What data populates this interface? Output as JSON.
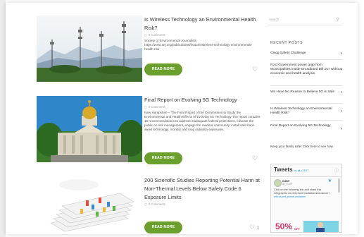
{
  "posts": [
    {
      "title": "Is Wireless Technology an Environmental Health Risk?",
      "comments": "0 Comments",
      "excerpt": "Society of Environmental Journalists https://www.sej.org/publications/feature/wireless-technology-environmental-health-risk",
      "read_more": "READ MORE",
      "likes": ""
    },
    {
      "title": "Final Report on Evolving 5G Technology",
      "comments": "0 Comments",
      "excerpt": "New Hampshire – The Final Report of the Commission to Study the Environmental and Health Effects of Evolving 5G Technology The report contains 15 recommendations to address inadequate federal protections, educate the public on risk management, engage the medical community, install safe hard-wired technology, monitor and map radiation exposures.",
      "read_more": "READ MORE",
      "likes": ""
    },
    {
      "title": "200 Scientific Studies Reporting Potential Harm at Non-Thermal Levels Below Safety Code 6 Exposure Limits",
      "comments": "0 Comments",
      "excerpt": "",
      "read_more": "READ MORE",
      "likes": "1"
    }
  ],
  "sidebar": {
    "search_placeholder": "Search",
    "recent_heading": "RECENT POSTS",
    "recent": [
      "Clegg Safety Challenge",
      "Ford Government power grab from Municipalities inside Broadband Bill 257 without economic and health analysis.",
      "We Have No Reason to Believe 5G is Safe",
      "Is Wireless Technology an Environmental Health Risk?",
      "Final Report on Evolving 5G Technology"
    ],
    "family_text": "Keep your family safe! Click here to see how.",
    "tweets": {
      "title": "Tweets",
      "by": "by @_C4ST",
      "author": "C4ST",
      "handle": "@_C4ST",
      "text": "Click on the following link and share this infographic on cell phone radiation and cancer!",
      "link": "wifi.ca/cell-phone-radiation",
      "ad_percent": "50%",
      "ad_off": "OFF"
    }
  },
  "colors": {
    "accent": "#6aa02b",
    "twitter": "#1b95e0"
  }
}
